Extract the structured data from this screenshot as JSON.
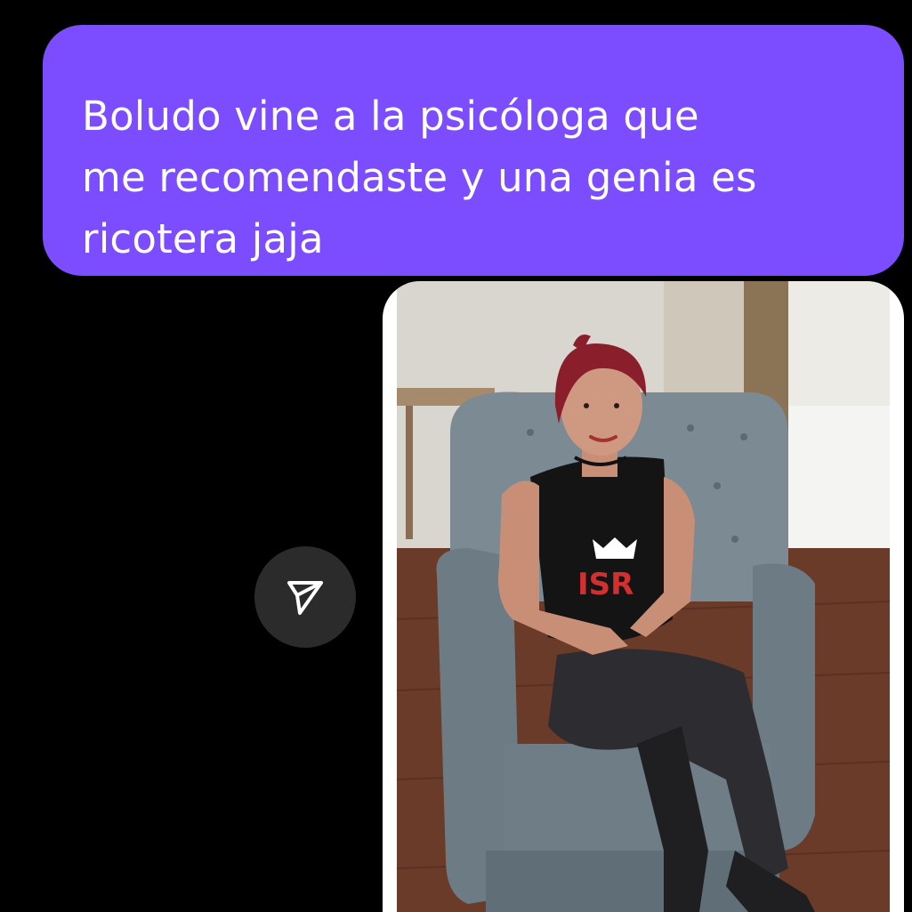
{
  "message": {
    "text_line1": "Boludo vine a la psicóloga que",
    "text_line2": "me recomendaste y una genia es",
    "text_line3": "ricotera jaja",
    "bubble_color": "#7c4dff"
  },
  "share_button": {
    "icon": "send-icon"
  },
  "photo": {
    "shirt_logo_text": "ISR"
  }
}
